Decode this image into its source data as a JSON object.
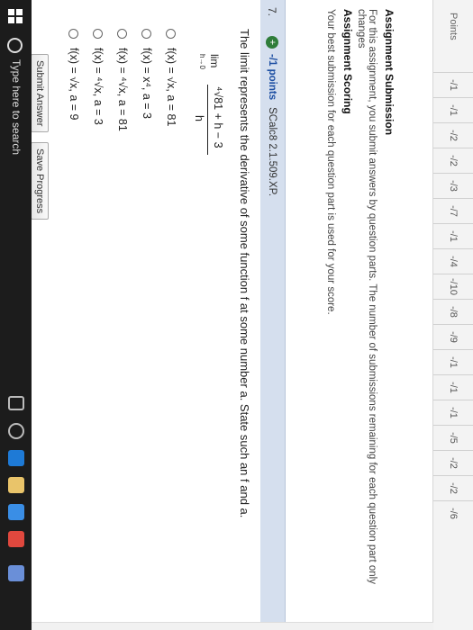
{
  "points": {
    "label": "Points",
    "values": [
      "-/1",
      "-/1",
      "-/2",
      "-/2",
      "-/3",
      "-/7",
      "-/1",
      "-/4",
      "-/10",
      "-/8",
      "-/9",
      "-/1",
      "-/1",
      "-/1",
      "-/5",
      "-/2",
      "-/2",
      "-/6"
    ]
  },
  "submission": {
    "title": "Assignment Submission",
    "text": "For this assignment, you submit answers by question parts. The number of submissions remaining for each question part only changes"
  },
  "scoring": {
    "title": "Assignment Scoring",
    "text": "Your best submission for each question part is used for your score."
  },
  "question": {
    "number": "7.",
    "plus": "+",
    "points": "-/1 points",
    "code": "SCalc8 2.1.509.XP.",
    "prompt": "The limit represents the derivative of some function f at some number a. State such an f and a.",
    "limit": {
      "lim": "lim",
      "sub": "h→0",
      "numerator": "⁴√81 + h − 3",
      "denominator": "h"
    },
    "options": [
      "f(x) = √x,  a = 81",
      "f(x) = x⁴,  a = 3",
      "f(x) = ⁴√x,  a = 81",
      "f(x) = ⁴√x,  a = 3",
      "f(x) = √x,  a = 9"
    ],
    "submit_label": "Submit Answer",
    "save_label": "Save Progress"
  },
  "taskbar": {
    "search_placeholder": "Type here to search"
  },
  "colors": {
    "question_bar": "#d5dfee",
    "points_link": "#1d4fa3",
    "taskbar": "#1c1c1c"
  }
}
